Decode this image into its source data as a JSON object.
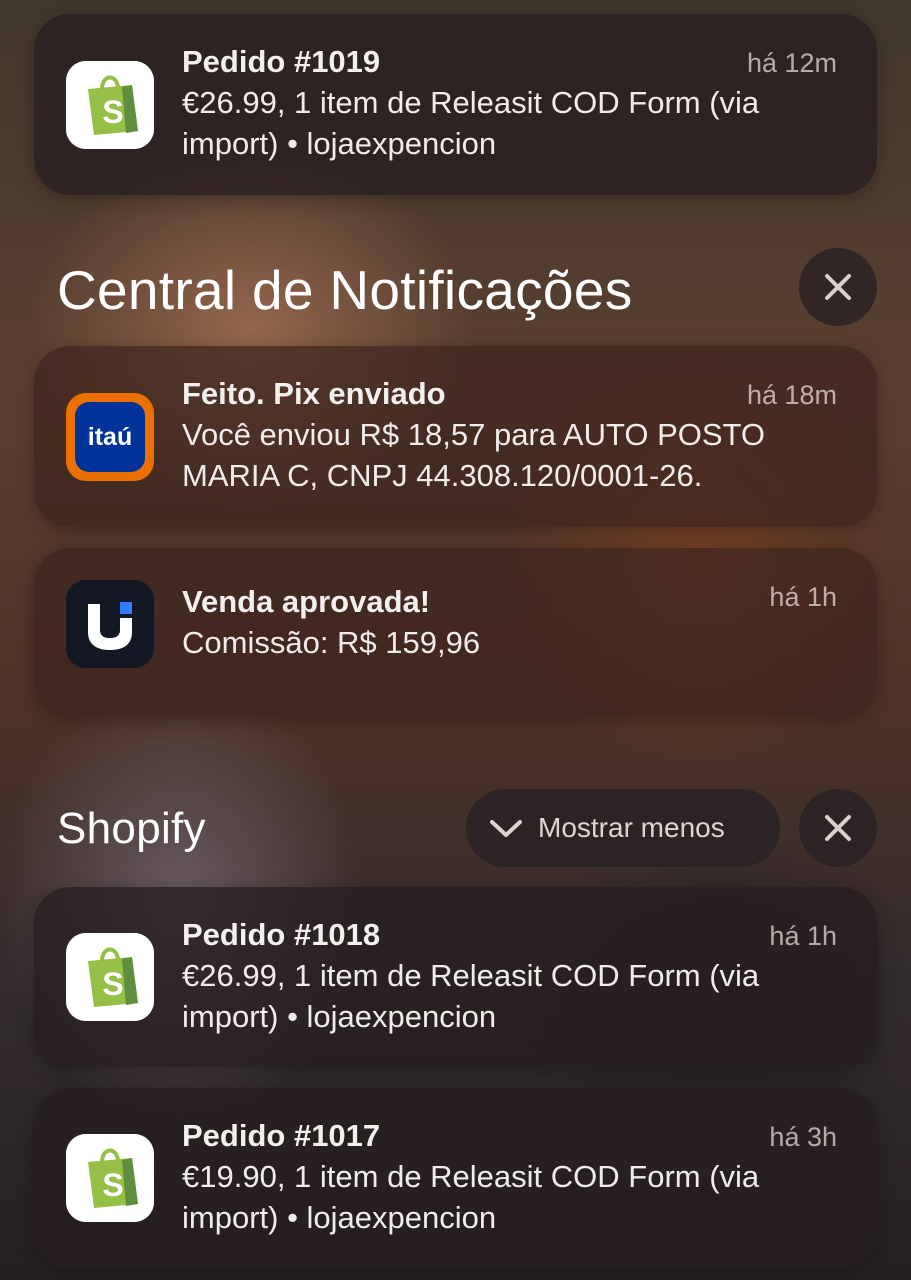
{
  "top_notification": {
    "app_icon": "shopify-bag-icon",
    "title": "Pedido #1019",
    "time": "há 12m",
    "body": "€26.99, 1 item de Releasit COD Form (via import) • lojaexpencion"
  },
  "notification_center": {
    "title": "Central de Notificações",
    "close_icon": "close-icon"
  },
  "notifications": [
    {
      "app_icon": "itau-icon",
      "icon_text": "itaú",
      "title": "Feito. Pix enviado",
      "time": "há 18m",
      "body": "Você enviou R$ 18,57 para AUTO POSTO MARIA C, CNPJ 44.308.120/0001-26."
    },
    {
      "app_icon": "u-app-icon",
      "title": "Venda aprovada!",
      "time": "há 1h",
      "body": "Comissão: R$ 159,96"
    }
  ],
  "shopify_group": {
    "title": "Shopify",
    "show_less_label": "Mostrar menos",
    "chevron_icon": "chevron-down-icon",
    "close_icon": "close-icon",
    "items": [
      {
        "app_icon": "shopify-bag-icon",
        "title": "Pedido #1018",
        "time": "há 1h",
        "body": "€26.99, 1 item de Releasit COD Form (via import) • lojaexpencion"
      },
      {
        "app_icon": "shopify-bag-icon",
        "title": "Pedido #1017",
        "time": "há 3h",
        "body": "€19.90, 1 item de Releasit COD Form (via import) • lojaexpencion"
      }
    ]
  },
  "colors": {
    "shopify_green": "#95BF47",
    "itau_orange": "#EC7000",
    "itau_blue": "#003399",
    "u_app_dark": "#141824"
  }
}
